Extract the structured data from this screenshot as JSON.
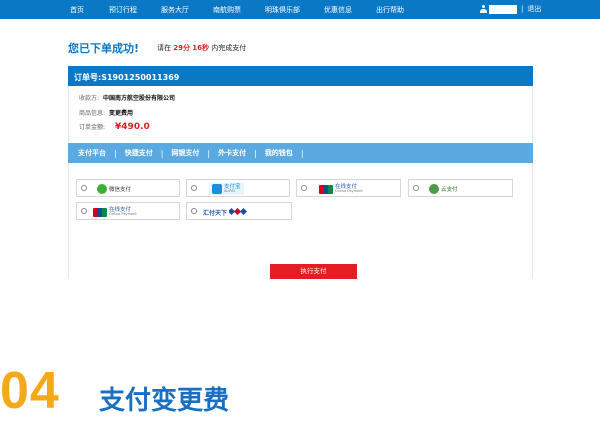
{
  "nav": {
    "items": [
      "首页",
      "预订行程",
      "服务大厅",
      "南航购票",
      "明珠俱乐部",
      "优惠信息",
      "出行帮助"
    ],
    "separator": "|",
    "logout": "退出"
  },
  "success": {
    "title": "您已下单成功!",
    "countdown_prefix": "请在",
    "minutes": "29分",
    "seconds": "16秒",
    "countdown_suffix": "内完成支付"
  },
  "order": {
    "number_label": "订单号:S1901250011369",
    "payee_label": "收款方:",
    "payee_value": "中国南方航空股份有限公司",
    "goods_label": "商品信息:",
    "goods_value": "变更费用",
    "amount_label": "订单金额:",
    "amount_value": "¥490.0"
  },
  "tabs": [
    "支付平台",
    "快捷支付",
    "网银支付",
    "外卡支付",
    "我的钱包"
  ],
  "payment_options": [
    {
      "name": "微信支付",
      "icon": "wechat-pay-icon",
      "color": "#3cb034"
    },
    {
      "name": "支付宝",
      "sub": "ALIPAY",
      "icon": "alipay-icon",
      "color": "#1a8fe0"
    },
    {
      "name": "在线支付",
      "sub": "Online Payment",
      "icon": "unionpay-icon",
      "color": "#d6001c"
    },
    {
      "name": "云支付",
      "icon": "cloud-pay-icon",
      "color": "#4d9a4a"
    },
    {
      "name": "在线支付",
      "sub": "Online Payment",
      "icon": "unionpay-icon",
      "color": "#d6001c"
    },
    {
      "name": "汇付天下",
      "icon": "chinapnr-icon",
      "color": "#1f4ea3"
    }
  ],
  "execute_button": "执行支付",
  "caption": {
    "number": "04",
    "title": "支付变更费"
  },
  "colors": {
    "primary_blue": "#0b78c6",
    "tab_blue": "#5aa9e0",
    "red": "#e31d22",
    "step_orange": "#f5a81a"
  }
}
